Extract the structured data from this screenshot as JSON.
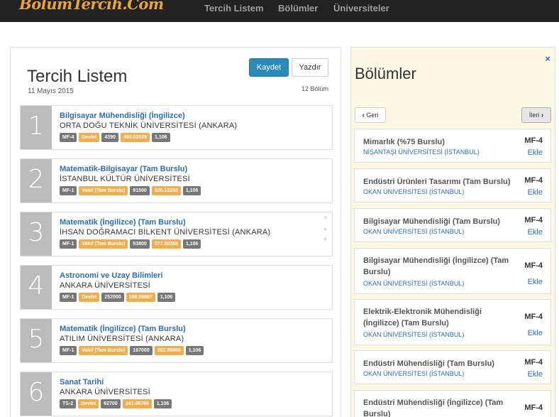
{
  "nav": {
    "brand": "BölümTercih.Com",
    "links": [
      "Tercih Listem",
      "Bölümler",
      "Üniversiteler"
    ]
  },
  "list": {
    "title": "Tercih Listem",
    "date": "11 Mayıs 2015",
    "save_label": "Kaydet",
    "print_label": "Yazdır",
    "count": "12 Bölüm",
    "choices": [
      {
        "num": "1",
        "program": "Bilgisayar Mühendisliği (İngilizce)",
        "university": "ORTA DOĞU TEKNİK ÜNİVERSİTESİ (ANKARA)",
        "type": "MF-4",
        "kind": "Devlet",
        "rank": "4390",
        "score": "493.02029",
        "coef": "1,106"
      },
      {
        "num": "2",
        "program": "Matematik-Bilgisayar (Tam Burslu)",
        "university": "İSTANBUL KÜLTÜR ÜNİVERSİTESİ",
        "type": "MF-1",
        "kind": "Vakıf (Tam Burslu)",
        "rank": "91500",
        "score": "326.13252",
        "coef": "1,106"
      },
      {
        "num": "3",
        "program": "Matematik (İngilizce) (Tam Burslu)",
        "university": "İHSAN DOĞRAMACI BİLKENT ÜNİVERSİTESİ (ANKARA)",
        "type": "MF-1",
        "kind": "Vakıf (Tam Burslu)",
        "rank": "53800",
        "score": "377.00368",
        "coef": "1,106"
      },
      {
        "num": "4",
        "program": "Astronomi ve Uzay Bilimleri",
        "university": "ANKARA ÜNİVERSİTESİ",
        "type": "MF-1",
        "kind": "Devlet",
        "rank": "252000",
        "score": "198.56867",
        "coef": "1,106"
      },
      {
        "num": "5",
        "program": "Matematik (İngilizce) (Tam Burslu)",
        "university": "ATILIM ÜNİVERSİTESİ (ANKARA)",
        "type": "MF-1",
        "kind": "Vakıf (Tam Burslu)",
        "rank": "167000",
        "score": "262.59869",
        "coef": "1,106"
      },
      {
        "num": "6",
        "program": "Sanat Tarihi",
        "university": "ANKARA ÜNİVERSİTESİ",
        "type": "TS-2",
        "kind": "Devlet",
        "rank": "62700",
        "score": "341.46769",
        "coef": "1,106"
      }
    ],
    "row_controls": {
      "remove": "×",
      "up": "▲",
      "down": "▼"
    }
  },
  "programs": {
    "title": "Bölümler",
    "close": "×",
    "back_label": "Geri",
    "next_label": "İleri",
    "add_label": "Ekle",
    "items": [
      {
        "name": "Mimarlık (%75 Burslu)",
        "university": "NİŞANTAŞI ÜNİVERSİTESİ (İSTANBUL)",
        "code": "MF-4"
      },
      {
        "name": "Endüstri Ürünleri Tasarımı (Tam Burslu)",
        "university": "OKAN ÜNİVERSİTESİ (İSTANBUL)",
        "code": "MF-4"
      },
      {
        "name": "Bilgisayar Mühendisliği (Tam Burslu)",
        "university": "OKAN ÜNİVERSİTESİ (İSTANBUL)",
        "code": "MF-4"
      },
      {
        "name": "Bilgisayar Mühendisliği (İngilizce) (Tam Burslu)",
        "university": "OKAN ÜNİVERSİTESİ (İSTANBUL)",
        "code": "MF-4"
      },
      {
        "name": "Elektrik-Elektronik Mühendisliği (İngilizce) (Tam Burslu)",
        "university": "OKAN ÜNİVERSİTESİ (İSTANBUL)",
        "code": "MF-4"
      },
      {
        "name": "Endüstri Mühendisliği (Tam Burslu)",
        "university": "OKAN ÜNİVERSİTESİ (İSTANBUL)",
        "code": "MF-4"
      },
      {
        "name": "Endüstri Mühendisliği (İngilizce) (Tam Burslu)",
        "university": "",
        "code": "MF-4"
      }
    ]
  }
}
